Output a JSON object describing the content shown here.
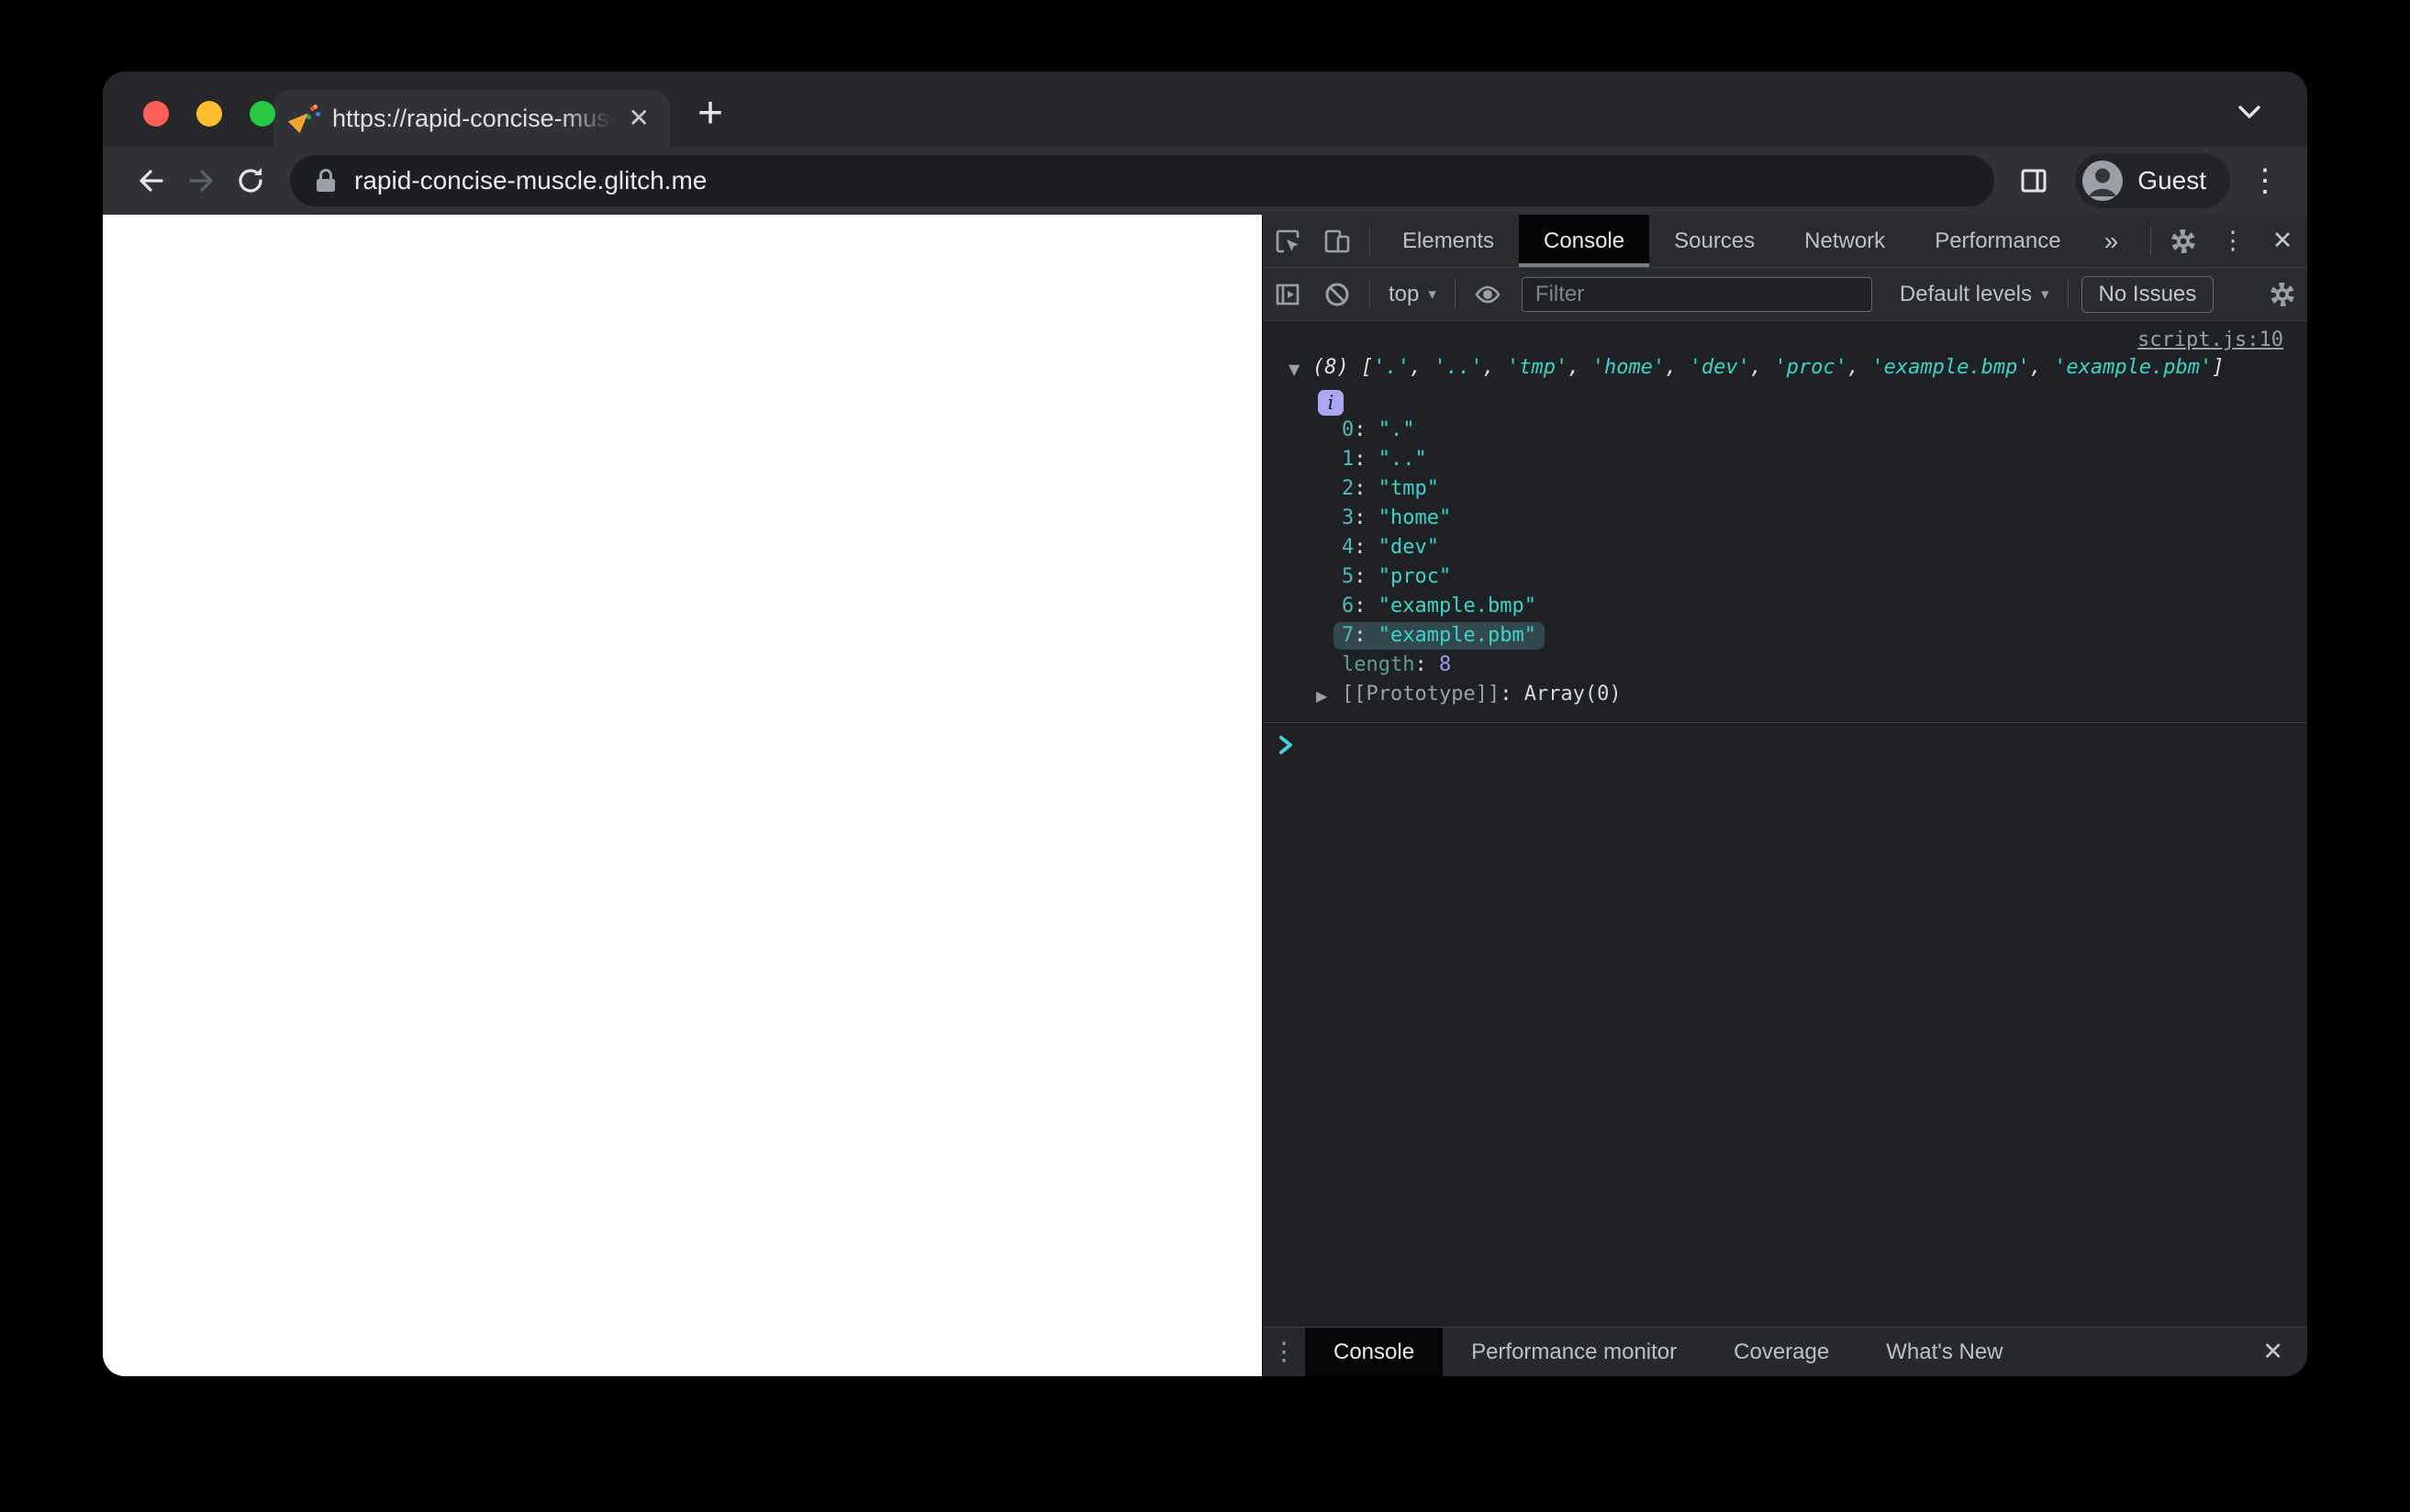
{
  "window": {
    "tab_title": "https://rapid-concise-muscle.g",
    "url": "rapid-concise-muscle.glitch.me",
    "profile_label": "Guest"
  },
  "devtools": {
    "main_tabs": [
      {
        "label": "Elements",
        "active": false
      },
      {
        "label": "Console",
        "active": true
      },
      {
        "label": "Sources",
        "active": false
      },
      {
        "label": "Network",
        "active": false
      },
      {
        "label": "Performance",
        "active": false
      }
    ],
    "more_tabs_symbol": "»",
    "console_toolbar": {
      "context_label": "top",
      "filter_placeholder": "Filter",
      "levels_label": "Default levels",
      "issues_label": "No Issues"
    },
    "console_message": {
      "source_link": "script.js:10",
      "array_preview": {
        "count": "(8)",
        "open_bracket": "[",
        "close_bracket": "]",
        "separator": ", ",
        "items": [
          "'.'",
          "'..'",
          "'tmp'",
          "'home'",
          "'dev'",
          "'proc'",
          "'example.bmp'",
          "'example.pbm'"
        ]
      },
      "entries": [
        {
          "index": "0",
          "value": "\".\"",
          "highlighted": false
        },
        {
          "index": "1",
          "value": "\"..\"",
          "highlighted": false
        },
        {
          "index": "2",
          "value": "\"tmp\"",
          "highlighted": false
        },
        {
          "index": "3",
          "value": "\"home\"",
          "highlighted": false
        },
        {
          "index": "4",
          "value": "\"dev\"",
          "highlighted": false
        },
        {
          "index": "5",
          "value": "\"proc\"",
          "highlighted": false
        },
        {
          "index": "6",
          "value": "\"example.bmp\"",
          "highlighted": false
        },
        {
          "index": "7",
          "value": "\"example.pbm\"",
          "highlighted": true
        }
      ],
      "length_label": "length",
      "length_value": "8",
      "prototype_label": "[[Prototype]]",
      "prototype_value": "Array(0)",
      "info_badge": "i",
      "expanded_triangle": "▼",
      "collapsed_triangle": "▶"
    },
    "drawer_tabs": [
      {
        "label": "Console",
        "active": true
      },
      {
        "label": "Performance monitor",
        "active": false
      },
      {
        "label": "Coverage",
        "active": false
      },
      {
        "label": "What's New",
        "active": false
      }
    ]
  },
  "icons": {
    "tab_close": "✕",
    "new_tab": "+",
    "kebab": "⋮",
    "devtools_close": "✕",
    "drawer_close": "✕",
    "dropdown_caret": "▾"
  },
  "colors": {
    "string_teal": "#38d5c8",
    "index_teal": "#4fbcb3",
    "number_purple": "#9a9bee",
    "highlight_bg": "#33484e",
    "prompt_teal": "#3fd4de",
    "link_gray": "#9aa0a6"
  }
}
